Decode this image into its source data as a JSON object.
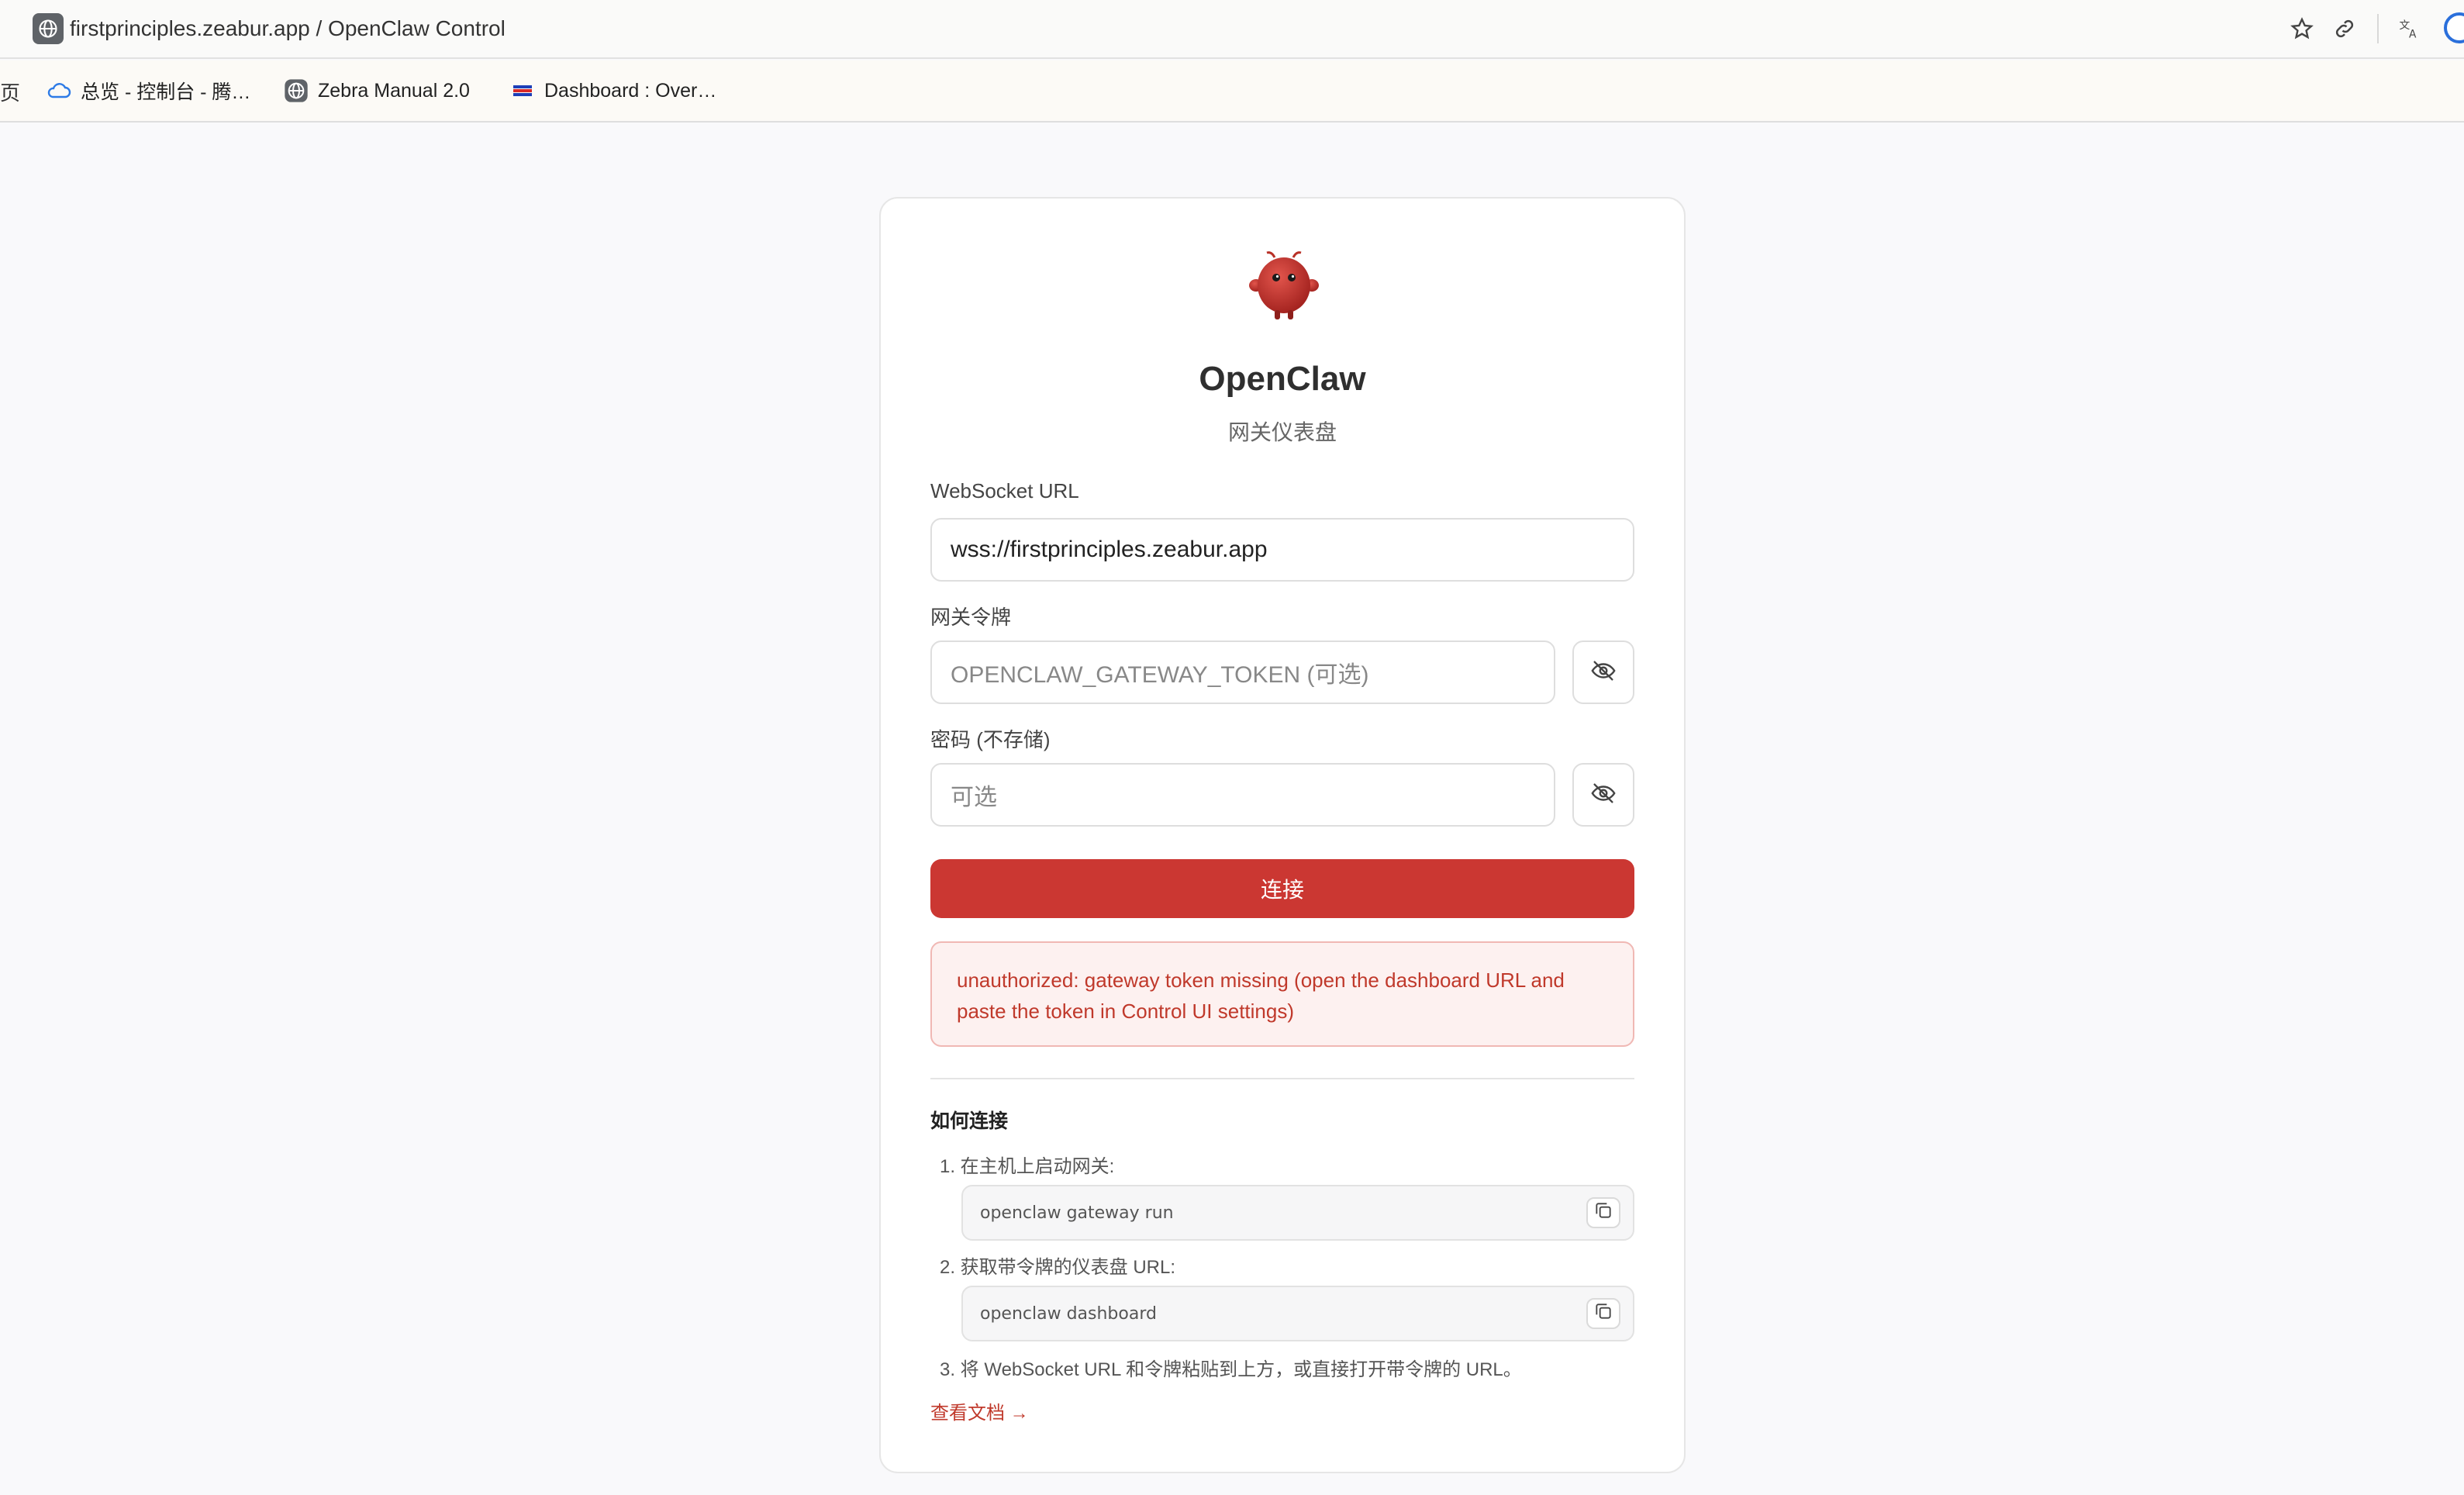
{
  "browser": {
    "address": "firstprinciples.zeabur.app / OpenClaw Control",
    "bookmark_edge_char": "页",
    "bookmarks": [
      {
        "label": "总览 - 控制台 - 腾…",
        "icon": "cloud-icon"
      },
      {
        "label": "Zebra Manual 2.0",
        "icon": "globe-icon"
      },
      {
        "label": "Dashboard : Over…",
        "icon": "zebra-flag-icon"
      }
    ],
    "toolbar_icons": [
      "star-icon",
      "link-icon",
      "translate-icon",
      "extension-icon"
    ]
  },
  "app": {
    "title": "OpenClaw",
    "subtitle": "网关仪表盘",
    "logo_icon": "openclaw-mascot-icon"
  },
  "form": {
    "websocket_label": "WebSocket URL",
    "websocket_value": "wss://firstprinciples.zeabur.app",
    "token_label": "网关令牌",
    "token_placeholder": "OPENCLAW_GATEWAY_TOKEN (可选)",
    "password_label": "密码 (不存储)",
    "password_placeholder": "可选",
    "connect_label": "连接"
  },
  "error": {
    "message": "unauthorized: gateway token missing (open the dashboard URL and paste the token in Control UI settings)"
  },
  "help": {
    "title": "如何连接",
    "step1": "1. 在主机上启动网关:",
    "code1": "openclaw gateway run",
    "step2": "2. 获取带令牌的仪表盘 URL:",
    "code2": "openclaw dashboard",
    "step3": "3. 将 WebSocket URL 和令牌粘贴到上方，或直接打开带令牌的 URL。",
    "docs_link": "查看文档 →"
  },
  "colors": {
    "accent": "#cb3732",
    "error_text": "#c0392b",
    "error_bg": "#fdf1f0",
    "error_border": "#f0b8b4",
    "page_bg": "#f9f9fb"
  }
}
